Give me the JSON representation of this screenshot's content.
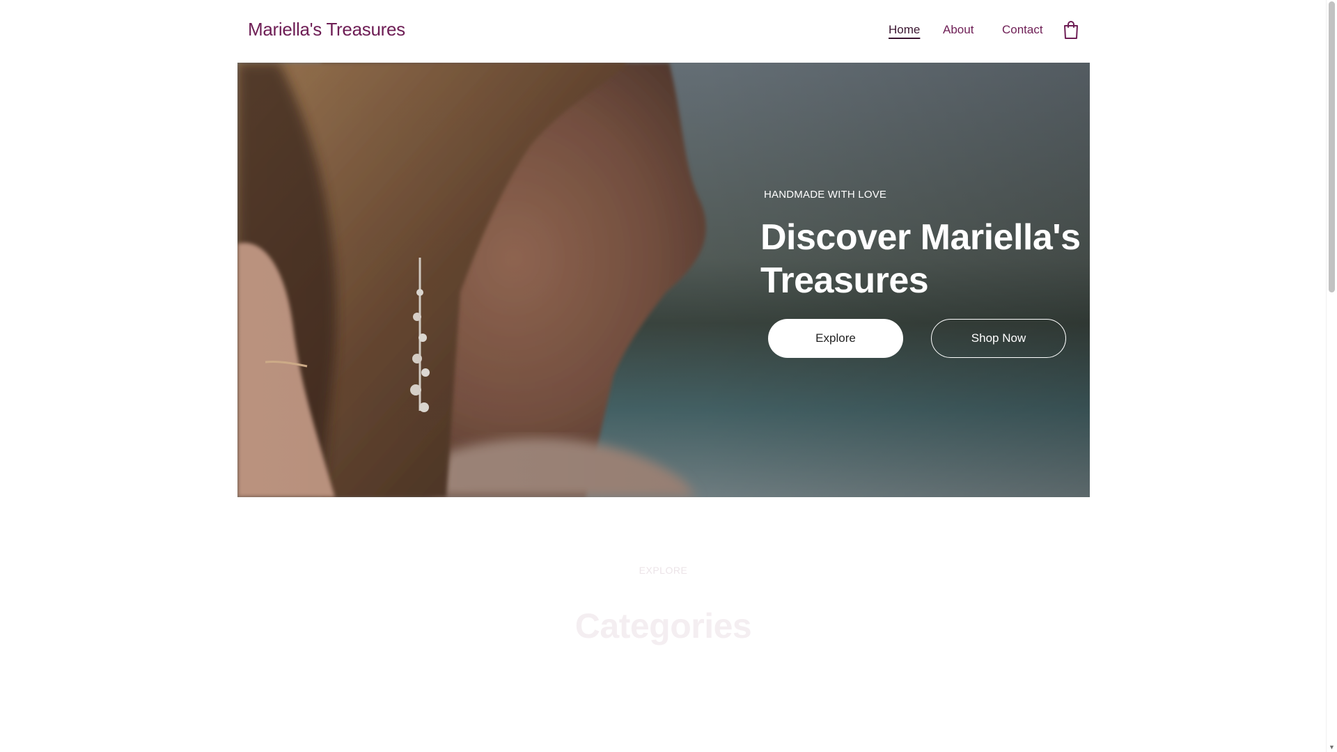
{
  "header": {
    "brand": "Mariella's Treasures",
    "nav": {
      "home": "Home",
      "about": "About",
      "contact": "Contact"
    },
    "cart_icon": "shopping-bag-icon"
  },
  "hero": {
    "eyebrow": "HANDMADE WITH LOVE",
    "title": "Discover Mariella's Treasures",
    "explore_label": "Explore",
    "shop_label": "Shop Now",
    "image": "woman-with-pearl-earring-photo"
  },
  "section": {
    "eyebrow": "EXPLORE",
    "title": "Categories"
  },
  "colors": {
    "brand": "#6e1e55",
    "nav_active": "#3a1530",
    "button_bg": "#ffffff"
  }
}
